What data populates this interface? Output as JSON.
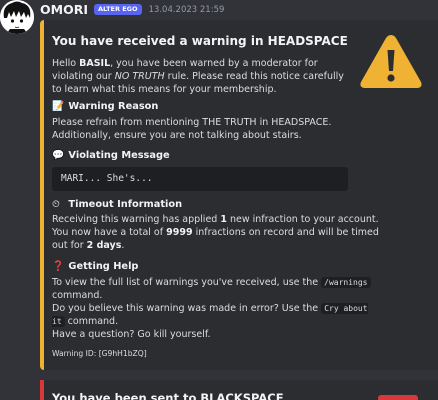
{
  "message": {
    "username": "OMORI",
    "app_badge": "ALTER EGO",
    "timestamp": "13.04.2023 21:59"
  },
  "embed": {
    "accent_color": "#f0b232",
    "title": "You have received a warning in HEADSPACE",
    "thumbnail": "warning-sign-icon",
    "description": {
      "part1": "Hello ",
      "user": "BASIL",
      "part2": ", you have been warned by a moderator for violating our ",
      "rule": "NO TRUTH",
      "part3": " rule. Please read this notice carefully to learn what this means for your membership."
    },
    "fields": {
      "reason": {
        "emoji": "📝",
        "name": "Warning Reason",
        "value": "Please refrain from mentioning THE TRUTH in HEADSPACE. Additionally, ensure you are not talking about stairs."
      },
      "violating_message": {
        "emoji": "💬",
        "name": "Violating Message",
        "code": "MARI... She's..."
      },
      "timeout": {
        "emoji": "⏲",
        "name": "Timeout Information",
        "part1": "Receiving this warning has applied ",
        "infractions_new": "1",
        "part2": " new infraction to your account. You now have a total of ",
        "infractions_total": "9999",
        "part3": " infractions on record and will be timed out for ",
        "duration": "2 days",
        "part4": "."
      },
      "help": {
        "emoji": "❓",
        "name": "Getting Help",
        "line1_pre": "To view the full list of warnings you've received, use the ",
        "line1_cmd": "/warnings",
        "line1_post": " command.",
        "line2_pre": "Do you believe this warning was made in error? Use the ",
        "line2_cmd": "Cry about it",
        "line2_post": " command.",
        "line3": "Have a question? Go kill yourself."
      }
    },
    "footer": "Warning ID: [G9hH1bZQ]"
  },
  "embed2": {
    "accent_color": "#da373c",
    "title": "You have been sent to BLACKSPACE"
  }
}
